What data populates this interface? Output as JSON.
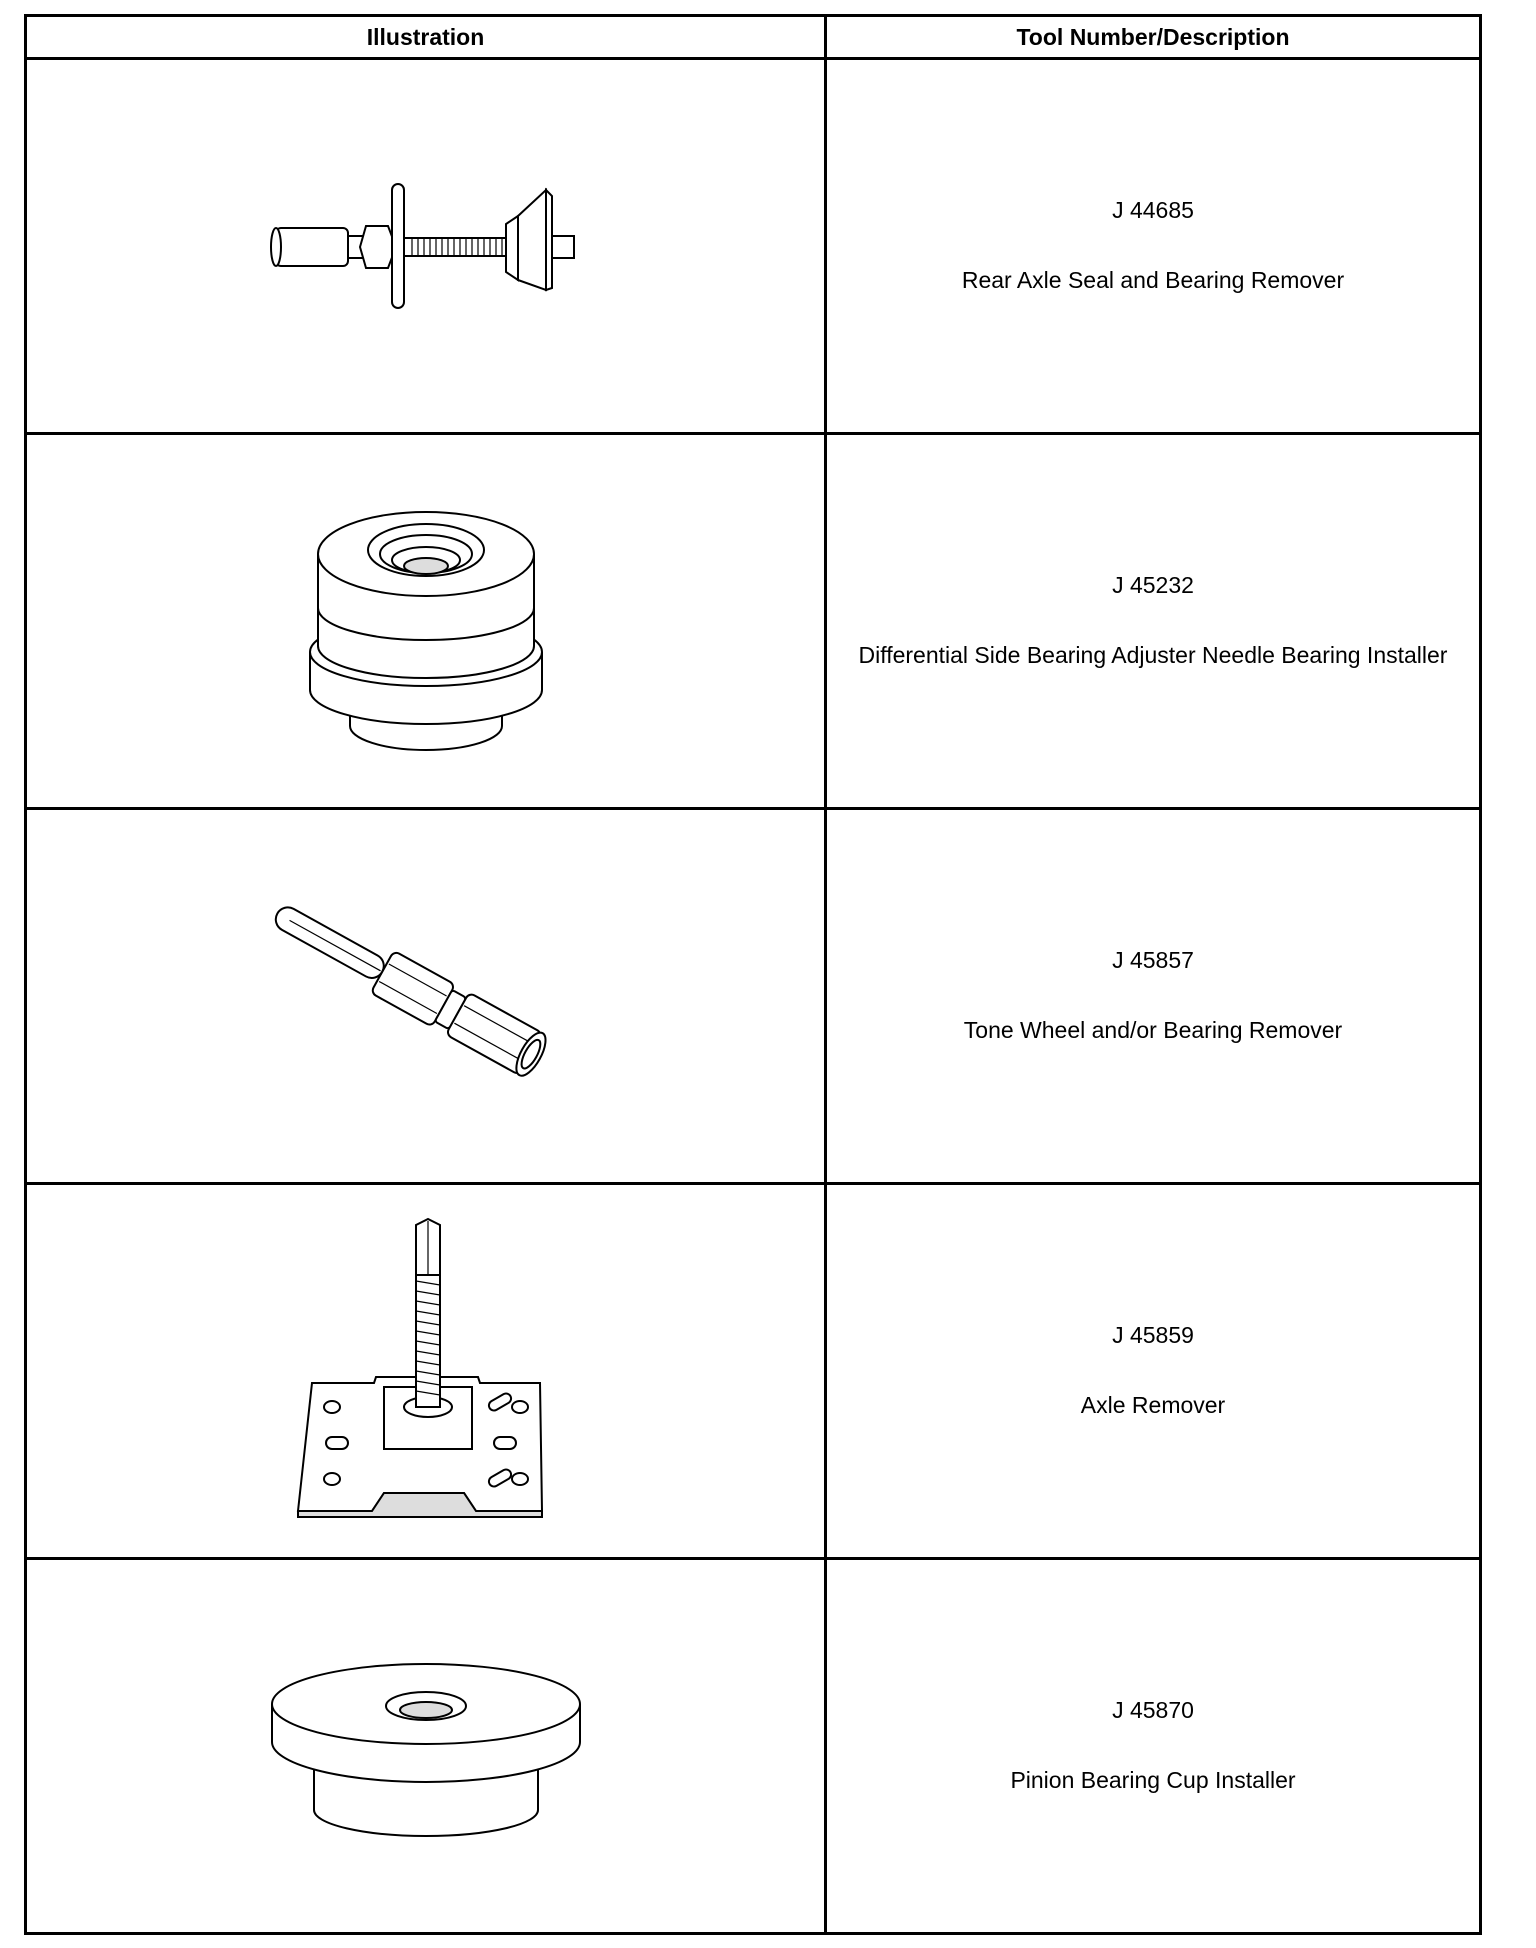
{
  "table": {
    "headers": {
      "illustration": "Illustration",
      "tool_description": "Tool Number/Description"
    },
    "rows": [
      {
        "number": "J 44685",
        "description": "Rear Axle Seal and Bearing Remover",
        "illustration_icon": "axle-seal-bearing-remover-icon"
      },
      {
        "number": "J 45232",
        "description": "Differential Side Bearing Adjuster Needle Bearing Installer",
        "illustration_icon": "needle-bearing-installer-icon"
      },
      {
        "number": "J 45857",
        "description": "Tone Wheel and/or Bearing Remover",
        "illustration_icon": "tone-wheel-remover-icon"
      },
      {
        "number": "J 45859",
        "description": "Axle Remover",
        "illustration_icon": "axle-remover-icon"
      },
      {
        "number": "J 45870",
        "description": "Pinion Bearing Cup Installer",
        "illustration_icon": "pinion-bearing-cup-installer-icon"
      }
    ]
  }
}
